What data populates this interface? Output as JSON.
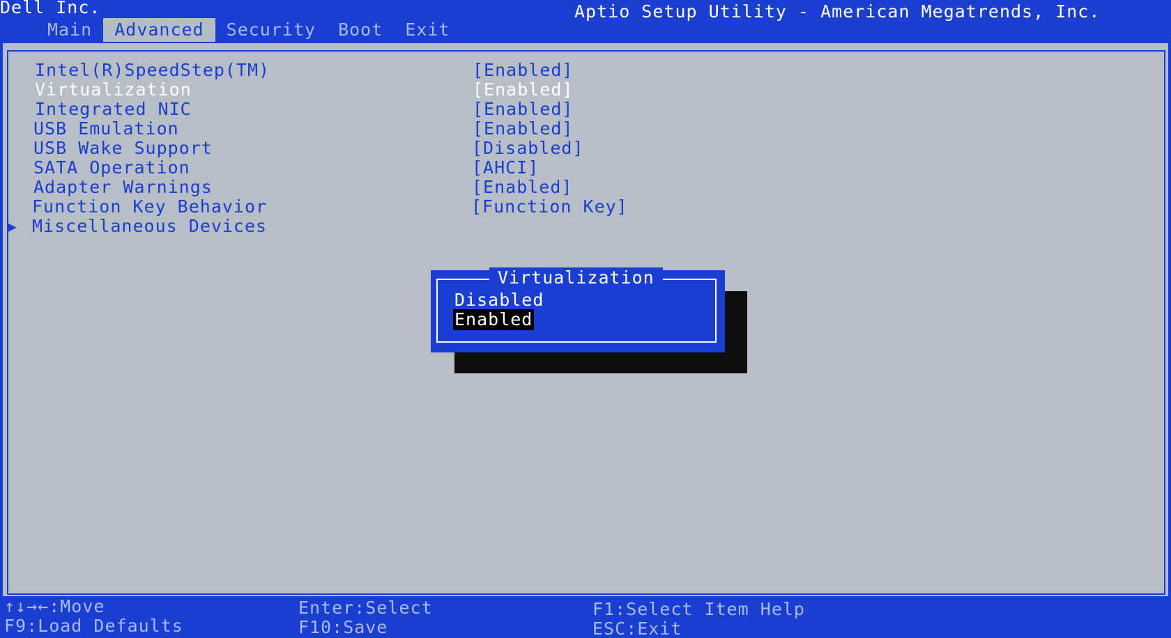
{
  "header": {
    "vendor": "Dell Inc.",
    "title": "Aptio Setup Utility - American Megatrends, Inc.",
    "tabs": [
      {
        "label": "Main"
      },
      {
        "label": "Advanced"
      },
      {
        "label": "Security"
      },
      {
        "label": "Boot"
      },
      {
        "label": "Exit"
      }
    ],
    "active_tab": "Advanced"
  },
  "settings": [
    {
      "label": "Intel(R)SpeedStep(TM)",
      "value": "[Enabled]"
    },
    {
      "label": "Virtualization",
      "value": "[Enabled]"
    },
    {
      "label": "Integrated NIC",
      "value": "[Enabled]"
    },
    {
      "label": "USB Emulation",
      "value": "[Enabled]"
    },
    {
      "label": "USB Wake Support",
      "value": "[Disabled]"
    },
    {
      "label": "SATA Operation",
      "value": "[AHCI]"
    },
    {
      "label": "Adapter Warnings",
      "value": "[Enabled]"
    },
    {
      "label": "Function Key Behavior",
      "value": "[Function Key]"
    },
    {
      "label": "Miscellaneous Devices",
      "submenu_marker": "▶"
    }
  ],
  "popup": {
    "title": "Virtualization",
    "options": [
      "Disabled",
      "Enabled"
    ],
    "selected": "Enabled"
  },
  "footer": {
    "move": "↑↓→←:Move",
    "load_defaults": "F9:Load Defaults",
    "select": "Enter:Select",
    "save": "F10:Save",
    "help": "F1:Select Item Help",
    "exit": "ESC:Exit"
  },
  "colors": {
    "bios_blue": "#1a3fd0",
    "panel_gray": "#b7bec6",
    "shadow": "#0d0d0d",
    "highlight_bg": "#000000"
  }
}
